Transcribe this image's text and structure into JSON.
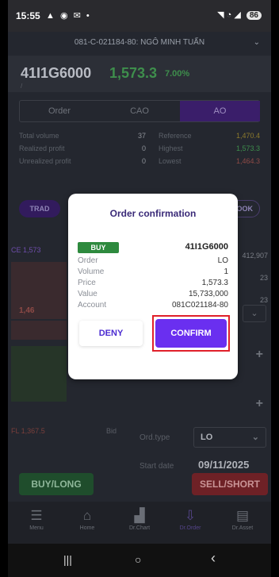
{
  "status_bar": {
    "time": "15:55",
    "icons": "▲ ◉ ✉ •",
    "signal": "◥ ◔ ◢",
    "battery": "86"
  },
  "account": {
    "label": "081-C-021184-80: NGÔ MINH TUẤN"
  },
  "symbol": {
    "code": "41I1G6000",
    "price": "1,573.3",
    "change_pct": "7.00%",
    "sub": "/"
  },
  "tabs": [
    {
      "label": "Order"
    },
    {
      "label": "CAO"
    },
    {
      "label": "AO"
    }
  ],
  "stats": {
    "rows": [
      {
        "label": "Total volume",
        "value": "37",
        "label2": "Reference",
        "value2": "1,470.4",
        "color2": "#8c7a2c"
      },
      {
        "label": "Realized profit",
        "value": "0",
        "label2": "Highest",
        "value2": "1,573.3",
        "color2": "#3e8e4c"
      },
      {
        "label": "Unrealized profit",
        "value": "0",
        "label2": "Lowest",
        "value2": "1,464.3",
        "color2": "#8e4a46"
      }
    ]
  },
  "buttons": {
    "trade": "TRAD",
    "order_book": "R BOOK"
  },
  "order_book": {
    "ce": "CE 1,573",
    "right_values": [
      "412,907",
      "23",
      "23"
    ],
    "red_label": "1,46",
    "fl": "FL 1,367.5",
    "bid": "Bid"
  },
  "order_form": {
    "ord_type_label": "Ord.type",
    "ord_type_value": "LO",
    "start_date_label": "Start date",
    "start_date_value": "09/11/2025"
  },
  "actions": {
    "buy_long": "BUY/LONG",
    "sell_short": "SELL/SHORT"
  },
  "bottom_nav": [
    {
      "label": "Menu",
      "icon": "☰"
    },
    {
      "label": "Home",
      "icon": "⌂"
    },
    {
      "label": "Dr.Chart",
      "icon": "▟"
    },
    {
      "label": "Dr.Order",
      "icon": "⇩"
    },
    {
      "label": "Dr.Asset",
      "icon": "▤"
    }
  ],
  "system_nav": {
    "recents": "|||",
    "home": "○",
    "back": "‹"
  },
  "dialog": {
    "title": "Order confirmation",
    "side": "BUY",
    "symbol": "41I1G6000",
    "rows": [
      {
        "key": "Order",
        "value": "LO"
      },
      {
        "key": "Volume",
        "value": "1"
      },
      {
        "key": "Price",
        "value": "1,573.3"
      },
      {
        "key": "Value",
        "value": "15,733,000"
      },
      {
        "key": "Account",
        "value": "081C021184-80"
      }
    ],
    "deny": "DENY",
    "confirm": "CONFIRM"
  },
  "colors": {
    "accent": "#6a2ff0",
    "buy": "#2e8a3e",
    "highlight": "#e0202a"
  }
}
